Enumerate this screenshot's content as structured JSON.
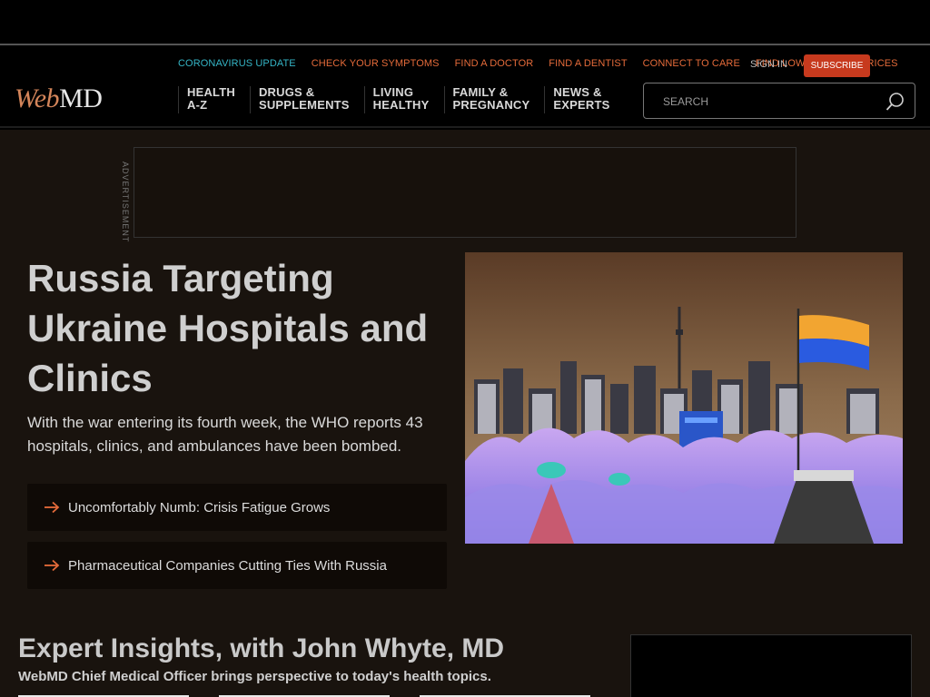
{
  "utility_links": [
    {
      "label": "CORONAVIRUS UPDATE",
      "kind": "covid"
    },
    {
      "label": "CHECK YOUR SYMPTOMS",
      "kind": "normal"
    },
    {
      "label": "FIND A DOCTOR",
      "kind": "normal"
    },
    {
      "label": "FIND A DENTIST",
      "kind": "normal"
    },
    {
      "label": "CONNECT TO CARE",
      "kind": "normal"
    },
    {
      "label": "FIND LOWEST DRUG PRICES",
      "kind": "normal"
    }
  ],
  "account": {
    "signin": "SIGN IN",
    "subscribe": "SUBSCRIBE"
  },
  "logo": {
    "web": "Web",
    "md": "MD"
  },
  "nav": [
    {
      "label": "HEALTH\nA-Z"
    },
    {
      "label": "DRUGS &\nSUPPLEMENTS"
    },
    {
      "label": "LIVING\nHEALTHY"
    },
    {
      "label": "FAMILY &\nPREGNANCY"
    },
    {
      "label": "NEWS &\nEXPERTS"
    }
  ],
  "search": {
    "placeholder": "SEARCH"
  },
  "ad": {
    "label": "ADVERTISEMENT"
  },
  "hero": {
    "title": "Russia Targeting Ukraine Hospitals and Clinics",
    "subtitle": "With the war entering its fourth week, the WHO reports 43 hospitals, clinics, and ambulances have been bombed.",
    "related": [
      {
        "label": "Uncomfortably Numb: Crisis Fatigue Grows"
      },
      {
        "label": "Pharmaceutical Companies Cutting Ties With Russia"
      }
    ]
  },
  "insights": {
    "title": "Expert Insights, with John Whyte, MD",
    "subtitle": "WebMD Chief Medical Officer brings perspective to today's health topics."
  },
  "colors": {
    "accent": "#e56b3a",
    "covid": "#35b5c6",
    "subscribe_bg": "#c73a1e",
    "content_bg": "#19130e"
  }
}
